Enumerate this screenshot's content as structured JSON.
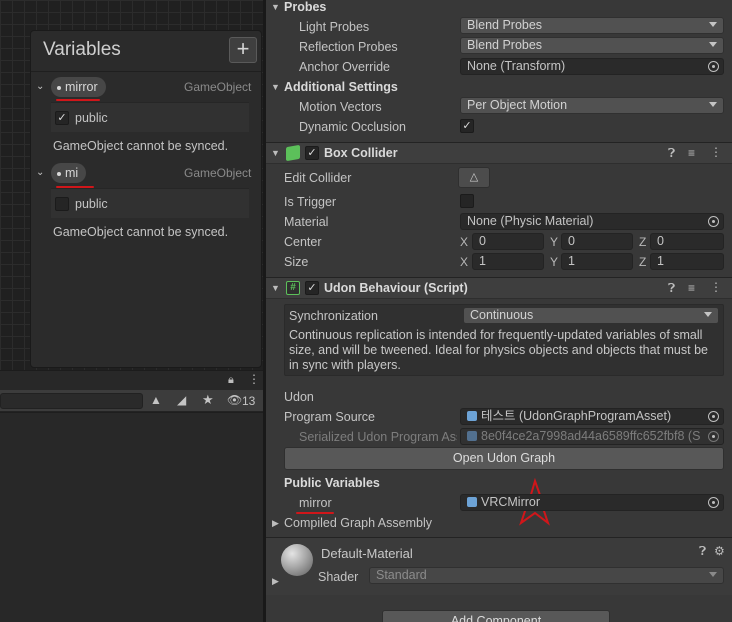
{
  "variables_panel": {
    "title": "Variables",
    "add_glyph": "+",
    "items": [
      {
        "name": "mirror",
        "type": "GameObject",
        "public_label": "public",
        "public_checked": true,
        "note": "GameObject cannot be synced."
      },
      {
        "name": "mi",
        "type": "GameObject",
        "public_label": "public",
        "public_checked": false,
        "note": "GameObject cannot be synced."
      }
    ]
  },
  "left_toolbar": {
    "hidden_count": "13"
  },
  "probes": {
    "header": "Probes",
    "light_probes_label": "Light Probes",
    "light_probes_value": "Blend Probes",
    "reflection_probes_label": "Reflection Probes",
    "reflection_probes_value": "Blend Probes",
    "anchor_override_label": "Anchor Override",
    "anchor_override_value": "None (Transform)"
  },
  "additional_settings": {
    "header": "Additional Settings",
    "motion_vectors_label": "Motion Vectors",
    "motion_vectors_value": "Per Object Motion",
    "dynamic_occlusion_label": "Dynamic Occlusion",
    "dynamic_occlusion_checked": true
  },
  "box_collider": {
    "title": "Box Collider",
    "edit_collider_label": "Edit Collider",
    "is_trigger_label": "Is Trigger",
    "material_label": "Material",
    "material_value": "None (Physic Material)",
    "center_label": "Center",
    "center": {
      "x": "0",
      "y": "0",
      "z": "0"
    },
    "size_label": "Size",
    "size": {
      "x": "1",
      "y": "1",
      "z": "1"
    }
  },
  "udon_behaviour": {
    "title": "Udon Behaviour (Script)",
    "synchronization_label": "Synchronization",
    "synchronization_value": "Continuous",
    "help_text": "Continuous replication is intended for frequently-updated variables of small size, and will be tweened. Ideal for physics objects and objects that must be in sync with players.",
    "udon_label": "Udon",
    "program_source_label": "Program Source",
    "program_source_value": "테스트 (UdonGraphProgramAsset)",
    "serialized_label": "Serialized Udon Program Ass",
    "serialized_value": "8e0f4ce2a7998ad44a6589ffc652fbf8 (S",
    "open_graph_button": "Open Udon Graph",
    "public_variables_label": "Public Variables",
    "public_var_name": "mirror",
    "public_var_value": "VRCMirror",
    "compiled_graph_label": "Compiled Graph Assembly"
  },
  "material": {
    "name": "Default-Material",
    "shader_label": "Shader",
    "shader_value": "Standard"
  },
  "add_component_button": "Add Component",
  "axis_labels": {
    "x": "X",
    "y": "Y",
    "z": "Z"
  },
  "colors": {
    "annotation_red": "#d0161a",
    "checkbox_green": "#5cc05a"
  }
}
